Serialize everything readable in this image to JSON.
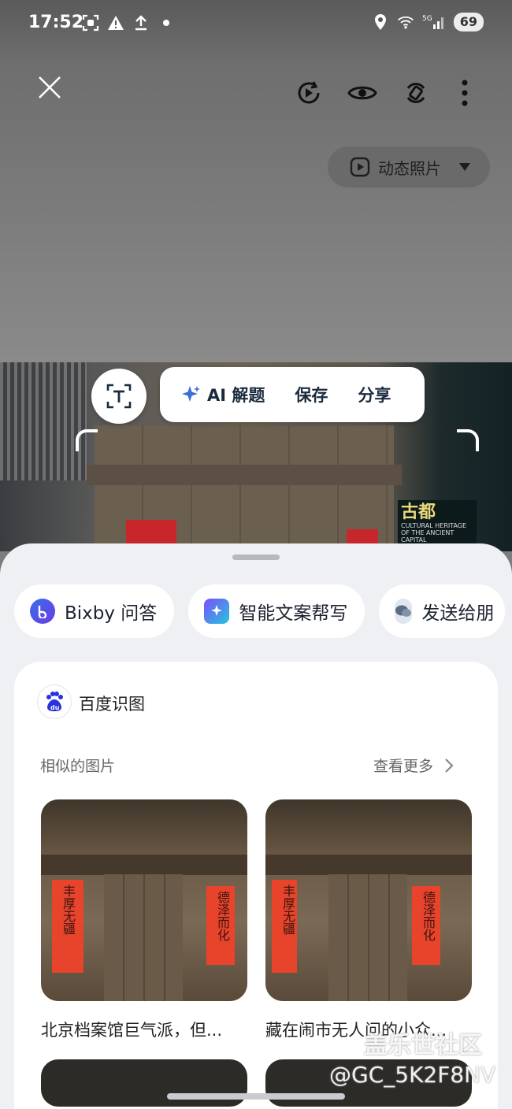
{
  "status": {
    "time": "17:52",
    "battery": "69",
    "network": "5G"
  },
  "toolbar": {
    "motion_label": "动态照片"
  },
  "actions": {
    "ai": "AI 解题",
    "save": "保存",
    "share": "分享"
  },
  "chips": [
    {
      "label": "Bixby 问答"
    },
    {
      "label": "智能文案帮写"
    },
    {
      "label": "发送给朋"
    }
  ],
  "baidu": {
    "title": "百度识图",
    "similar_label": "相似的图片",
    "see_more": "查看更多",
    "results": [
      {
        "caption": "北京档案馆巨气派，但...",
        "couplet_left": "丰厚无疆",
        "couplet_right": "德泽而化"
      },
      {
        "caption": "藏在闹市无人问的小众...",
        "couplet_left": "丰厚无疆",
        "couplet_right": "德泽而化"
      }
    ]
  },
  "photo": {
    "sign_big": "古都",
    "sign_small": "CULTURAL HERITAGE OF THE ANCIENT CAPITAL"
  },
  "watermark": {
    "line1": "盖乐世社区",
    "line2": "@GC_5K2F8NV"
  },
  "colors": {
    "sheet_bg": "#eef0f4",
    "accent_red": "#c7262b",
    "text_dark": "#1a2b3c"
  }
}
